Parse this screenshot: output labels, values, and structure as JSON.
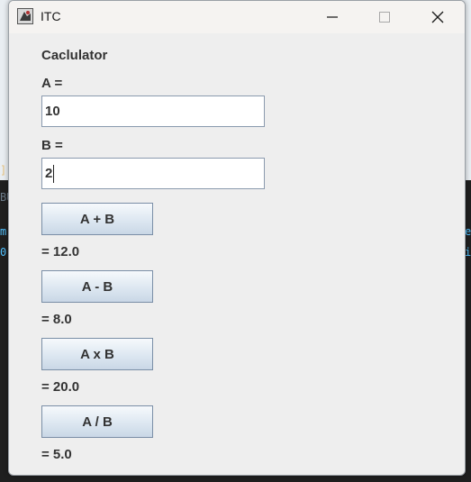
{
  "window": {
    "title": "ITC",
    "controls": {
      "minimize": "minimize-icon",
      "maximize": "maximize-icon",
      "close": "close-icon"
    }
  },
  "form": {
    "heading": "Caclulator",
    "a_label": "A =",
    "a_value": "10",
    "b_label": "B =",
    "b_value": "2"
  },
  "operations": [
    {
      "button": "A + B",
      "result": "= 12.0"
    },
    {
      "button": "A - B",
      "result": "= 8.0"
    },
    {
      "button": "A x B",
      "result": "= 20.0"
    },
    {
      "button": "A / B",
      "result": "= 5.0"
    }
  ]
}
